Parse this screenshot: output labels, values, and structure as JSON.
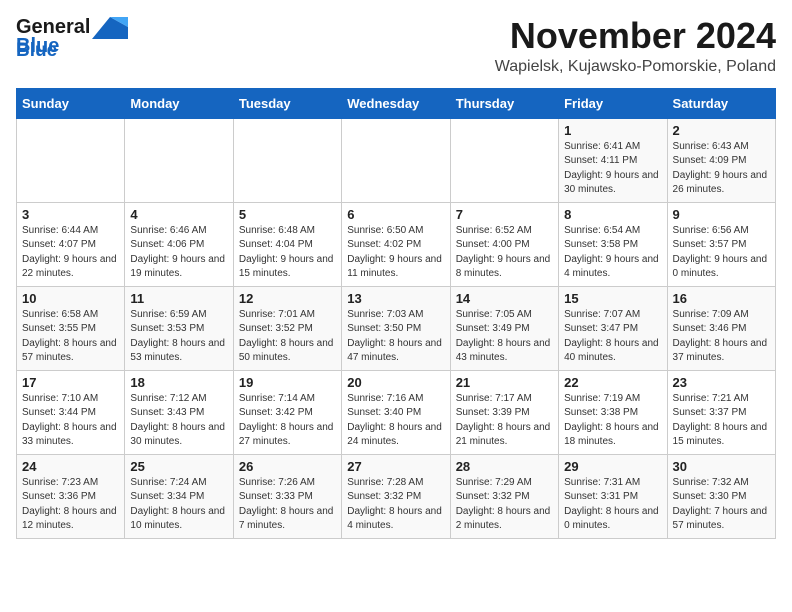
{
  "logo": {
    "general": "General",
    "blue": "Blue"
  },
  "header": {
    "month": "November 2024",
    "location": "Wapielsk, Kujawsko-Pomorskie, Poland"
  },
  "weekdays": [
    "Sunday",
    "Monday",
    "Tuesday",
    "Wednesday",
    "Thursday",
    "Friday",
    "Saturday"
  ],
  "weeks": [
    [
      {
        "day": "",
        "info": ""
      },
      {
        "day": "",
        "info": ""
      },
      {
        "day": "",
        "info": ""
      },
      {
        "day": "",
        "info": ""
      },
      {
        "day": "",
        "info": ""
      },
      {
        "day": "1",
        "info": "Sunrise: 6:41 AM\nSunset: 4:11 PM\nDaylight: 9 hours and 30 minutes."
      },
      {
        "day": "2",
        "info": "Sunrise: 6:43 AM\nSunset: 4:09 PM\nDaylight: 9 hours and 26 minutes."
      }
    ],
    [
      {
        "day": "3",
        "info": "Sunrise: 6:44 AM\nSunset: 4:07 PM\nDaylight: 9 hours and 22 minutes."
      },
      {
        "day": "4",
        "info": "Sunrise: 6:46 AM\nSunset: 4:06 PM\nDaylight: 9 hours and 19 minutes."
      },
      {
        "day": "5",
        "info": "Sunrise: 6:48 AM\nSunset: 4:04 PM\nDaylight: 9 hours and 15 minutes."
      },
      {
        "day": "6",
        "info": "Sunrise: 6:50 AM\nSunset: 4:02 PM\nDaylight: 9 hours and 11 minutes."
      },
      {
        "day": "7",
        "info": "Sunrise: 6:52 AM\nSunset: 4:00 PM\nDaylight: 9 hours and 8 minutes."
      },
      {
        "day": "8",
        "info": "Sunrise: 6:54 AM\nSunset: 3:58 PM\nDaylight: 9 hours and 4 minutes."
      },
      {
        "day": "9",
        "info": "Sunrise: 6:56 AM\nSunset: 3:57 PM\nDaylight: 9 hours and 0 minutes."
      }
    ],
    [
      {
        "day": "10",
        "info": "Sunrise: 6:58 AM\nSunset: 3:55 PM\nDaylight: 8 hours and 57 minutes."
      },
      {
        "day": "11",
        "info": "Sunrise: 6:59 AM\nSunset: 3:53 PM\nDaylight: 8 hours and 53 minutes."
      },
      {
        "day": "12",
        "info": "Sunrise: 7:01 AM\nSunset: 3:52 PM\nDaylight: 8 hours and 50 minutes."
      },
      {
        "day": "13",
        "info": "Sunrise: 7:03 AM\nSunset: 3:50 PM\nDaylight: 8 hours and 47 minutes."
      },
      {
        "day": "14",
        "info": "Sunrise: 7:05 AM\nSunset: 3:49 PM\nDaylight: 8 hours and 43 minutes."
      },
      {
        "day": "15",
        "info": "Sunrise: 7:07 AM\nSunset: 3:47 PM\nDaylight: 8 hours and 40 minutes."
      },
      {
        "day": "16",
        "info": "Sunrise: 7:09 AM\nSunset: 3:46 PM\nDaylight: 8 hours and 37 minutes."
      }
    ],
    [
      {
        "day": "17",
        "info": "Sunrise: 7:10 AM\nSunset: 3:44 PM\nDaylight: 8 hours and 33 minutes."
      },
      {
        "day": "18",
        "info": "Sunrise: 7:12 AM\nSunset: 3:43 PM\nDaylight: 8 hours and 30 minutes."
      },
      {
        "day": "19",
        "info": "Sunrise: 7:14 AM\nSunset: 3:42 PM\nDaylight: 8 hours and 27 minutes."
      },
      {
        "day": "20",
        "info": "Sunrise: 7:16 AM\nSunset: 3:40 PM\nDaylight: 8 hours and 24 minutes."
      },
      {
        "day": "21",
        "info": "Sunrise: 7:17 AM\nSunset: 3:39 PM\nDaylight: 8 hours and 21 minutes."
      },
      {
        "day": "22",
        "info": "Sunrise: 7:19 AM\nSunset: 3:38 PM\nDaylight: 8 hours and 18 minutes."
      },
      {
        "day": "23",
        "info": "Sunrise: 7:21 AM\nSunset: 3:37 PM\nDaylight: 8 hours and 15 minutes."
      }
    ],
    [
      {
        "day": "24",
        "info": "Sunrise: 7:23 AM\nSunset: 3:36 PM\nDaylight: 8 hours and 12 minutes."
      },
      {
        "day": "25",
        "info": "Sunrise: 7:24 AM\nSunset: 3:34 PM\nDaylight: 8 hours and 10 minutes."
      },
      {
        "day": "26",
        "info": "Sunrise: 7:26 AM\nSunset: 3:33 PM\nDaylight: 8 hours and 7 minutes."
      },
      {
        "day": "27",
        "info": "Sunrise: 7:28 AM\nSunset: 3:32 PM\nDaylight: 8 hours and 4 minutes."
      },
      {
        "day": "28",
        "info": "Sunrise: 7:29 AM\nSunset: 3:32 PM\nDaylight: 8 hours and 2 minutes."
      },
      {
        "day": "29",
        "info": "Sunrise: 7:31 AM\nSunset: 3:31 PM\nDaylight: 8 hours and 0 minutes."
      },
      {
        "day": "30",
        "info": "Sunrise: 7:32 AM\nSunset: 3:30 PM\nDaylight: 7 hours and 57 minutes."
      }
    ]
  ]
}
